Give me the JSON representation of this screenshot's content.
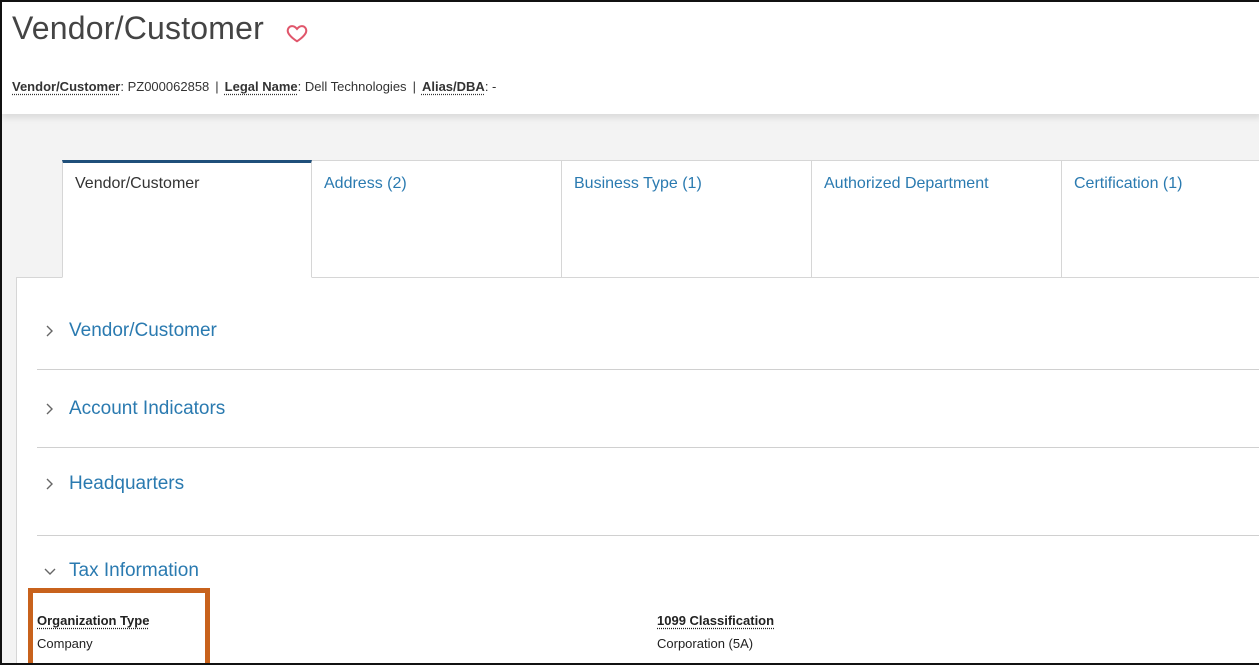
{
  "header": {
    "title": "Vendor/Customer",
    "favorite_icon": "heart-outline-icon",
    "favorite_color": "#e0566b",
    "meta": {
      "vendor_label": "Vendor/Customer",
      "vendor_value": "PZ000062858",
      "legal_label": "Legal Name",
      "legal_value": "Dell Technologies",
      "alias_label": "Alias/DBA",
      "alias_value": "-",
      "separator": "|"
    }
  },
  "tabs": [
    {
      "label": "Vendor/Customer",
      "active": true
    },
    {
      "label": "Address (2)",
      "active": false
    },
    {
      "label": "Business Type (1)",
      "active": false
    },
    {
      "label": "Authorized Department",
      "active": false
    },
    {
      "label": "Certification (1)",
      "active": false
    }
  ],
  "sections": {
    "vendor_customer": "Vendor/Customer",
    "account_indicators": "Account Indicators",
    "headquarters": "Headquarters",
    "tax_information": "Tax Information"
  },
  "tax": {
    "org_type_label": "Organization Type",
    "org_type_value": "Company",
    "classification_label": "1099 Classification",
    "classification_value": "Corporation (5A)"
  },
  "colors": {
    "accent_link": "#2a7ab0",
    "active_tab_border": "#1f4f7a",
    "highlight": "#c8621c"
  }
}
